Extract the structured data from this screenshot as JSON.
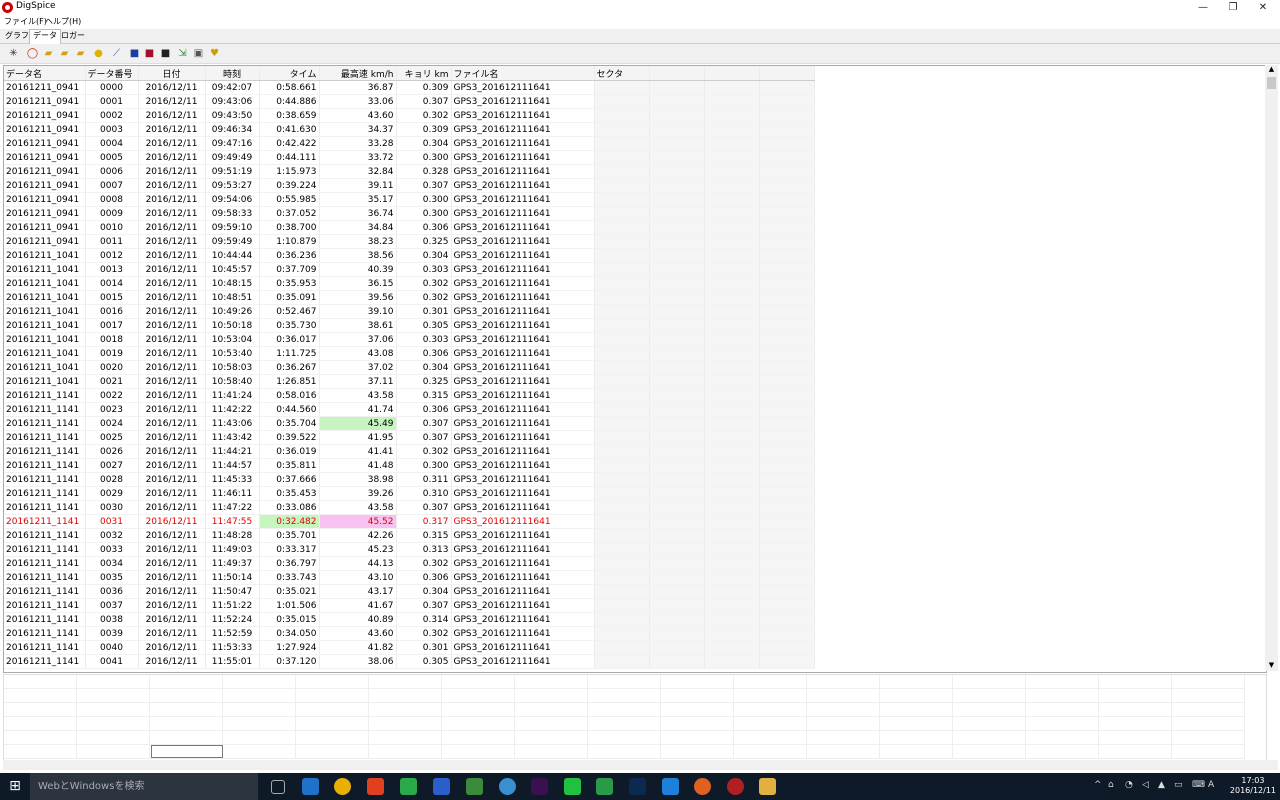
{
  "window": {
    "title": "DigSpice",
    "controls": {
      "minimize": "—",
      "maximize": "❐",
      "close": "✕"
    }
  },
  "menu": [
    "ファイル(F)",
    "ヘルプ(H)"
  ],
  "tabs": [
    {
      "label": "グラフ",
      "active": false
    },
    {
      "label": "データ",
      "active": true
    },
    {
      "label": "ロガー",
      "active": false
    }
  ],
  "toolbar_icons": [
    {
      "name": "spark-icon",
      "glyph": "✳",
      "color": "#333333"
    },
    {
      "name": "ring-icon",
      "glyph": "◯",
      "color": "#cc2200"
    },
    {
      "name": "folder-open-icon",
      "glyph": "▰",
      "color": "#d4a017"
    },
    {
      "name": "folder-icon",
      "glyph": "▰",
      "color": "#d4a017"
    },
    {
      "name": "folder-add-icon",
      "glyph": "▰",
      "color": "#d4a017"
    },
    {
      "name": "coin-icon",
      "glyph": "●",
      "color": "#e0b000"
    },
    {
      "name": "chart-icon",
      "glyph": "⟋",
      "color": "#2a5fc9"
    },
    {
      "name": "save-icon",
      "glyph": "■",
      "color": "#1c3fa0"
    },
    {
      "name": "save-red-icon",
      "glyph": "■",
      "color": "#a0102a"
    },
    {
      "name": "save-dark-icon",
      "glyph": "■",
      "color": "#202020"
    },
    {
      "name": "export-icon",
      "glyph": "⇲",
      "color": "#2a8a2a"
    },
    {
      "name": "picture-icon",
      "glyph": "▣",
      "color": "#555555"
    },
    {
      "name": "trophy-icon",
      "glyph": "♥",
      "color": "#c9a000"
    }
  ],
  "table": {
    "columns": [
      "データ名",
      "データ番号",
      "日付",
      "時刻",
      "タイム",
      "最高速 km/h",
      "キョリ km",
      "ファイル名",
      "セクタ"
    ],
    "rows": [
      [
        "20161211_0941",
        "0000",
        "2016/12/11",
        "09:42:07",
        "0:58.661",
        "36.87",
        "0.309",
        "GPS3_201612111641"
      ],
      [
        "20161211_0941",
        "0001",
        "2016/12/11",
        "09:43:06",
        "0:44.886",
        "33.06",
        "0.307",
        "GPS3_201612111641"
      ],
      [
        "20161211_0941",
        "0002",
        "2016/12/11",
        "09:43:50",
        "0:38.659",
        "43.60",
        "0.302",
        "GPS3_201612111641"
      ],
      [
        "20161211_0941",
        "0003",
        "2016/12/11",
        "09:46:34",
        "0:41.630",
        "34.37",
        "0.309",
        "GPS3_201612111641"
      ],
      [
        "20161211_0941",
        "0004",
        "2016/12/11",
        "09:47:16",
        "0:42.422",
        "33.28",
        "0.304",
        "GPS3_201612111641"
      ],
      [
        "20161211_0941",
        "0005",
        "2016/12/11",
        "09:49:49",
        "0:44.111",
        "33.72",
        "0.300",
        "GPS3_201612111641"
      ],
      [
        "20161211_0941",
        "0006",
        "2016/12/11",
        "09:51:19",
        "1:15.973",
        "32.84",
        "0.328",
        "GPS3_201612111641"
      ],
      [
        "20161211_0941",
        "0007",
        "2016/12/11",
        "09:53:27",
        "0:39.224",
        "39.11",
        "0.307",
        "GPS3_201612111641"
      ],
      [
        "20161211_0941",
        "0008",
        "2016/12/11",
        "09:54:06",
        "0:55.985",
        "35.17",
        "0.300",
        "GPS3_201612111641"
      ],
      [
        "20161211_0941",
        "0009",
        "2016/12/11",
        "09:58:33",
        "0:37.052",
        "36.74",
        "0.300",
        "GPS3_201612111641"
      ],
      [
        "20161211_0941",
        "0010",
        "2016/12/11",
        "09:59:10",
        "0:38.700",
        "34.84",
        "0.306",
        "GPS3_201612111641"
      ],
      [
        "20161211_0941",
        "0011",
        "2016/12/11",
        "09:59:49",
        "1:10.879",
        "38.23",
        "0.325",
        "GPS3_201612111641"
      ],
      [
        "20161211_1041",
        "0012",
        "2016/12/11",
        "10:44:44",
        "0:36.236",
        "38.56",
        "0.304",
        "GPS3_201612111641"
      ],
      [
        "20161211_1041",
        "0013",
        "2016/12/11",
        "10:45:57",
        "0:37.709",
        "40.39",
        "0.303",
        "GPS3_201612111641"
      ],
      [
        "20161211_1041",
        "0014",
        "2016/12/11",
        "10:48:15",
        "0:35.953",
        "36.15",
        "0.302",
        "GPS3_201612111641"
      ],
      [
        "20161211_1041",
        "0015",
        "2016/12/11",
        "10:48:51",
        "0:35.091",
        "39.56",
        "0.302",
        "GPS3_201612111641"
      ],
      [
        "20161211_1041",
        "0016",
        "2016/12/11",
        "10:49:26",
        "0:52.467",
        "39.10",
        "0.301",
        "GPS3_201612111641"
      ],
      [
        "20161211_1041",
        "0017",
        "2016/12/11",
        "10:50:18",
        "0:35.730",
        "38.61",
        "0.305",
        "GPS3_201612111641"
      ],
      [
        "20161211_1041",
        "0018",
        "2016/12/11",
        "10:53:04",
        "0:36.017",
        "37.06",
        "0.303",
        "GPS3_201612111641"
      ],
      [
        "20161211_1041",
        "0019",
        "2016/12/11",
        "10:53:40",
        "1:11.725",
        "43.08",
        "0.306",
        "GPS3_201612111641"
      ],
      [
        "20161211_1041",
        "0020",
        "2016/12/11",
        "10:58:03",
        "0:36.267",
        "37.02",
        "0.304",
        "GPS3_201612111641"
      ],
      [
        "20161211_1041",
        "0021",
        "2016/12/11",
        "10:58:40",
        "1:26.851",
        "37.11",
        "0.325",
        "GPS3_201612111641"
      ],
      [
        "20161211_1141",
        "0022",
        "2016/12/11",
        "11:41:24",
        "0:58.016",
        "43.58",
        "0.315",
        "GPS3_201612111641"
      ],
      [
        "20161211_1141",
        "0023",
        "2016/12/11",
        "11:42:22",
        "0:44.560",
        "41.74",
        "0.306",
        "GPS3_201612111641"
      ],
      [
        "20161211_1141",
        "0024",
        "2016/12/11",
        "11:43:06",
        "0:35.704",
        "45.49",
        "0.307",
        "GPS3_201612111641"
      ],
      [
        "20161211_1141",
        "0025",
        "2016/12/11",
        "11:43:42",
        "0:39.522",
        "41.95",
        "0.307",
        "GPS3_201612111641"
      ],
      [
        "20161211_1141",
        "0026",
        "2016/12/11",
        "11:44:21",
        "0:36.019",
        "41.41",
        "0.302",
        "GPS3_201612111641"
      ],
      [
        "20161211_1141",
        "0027",
        "2016/12/11",
        "11:44:57",
        "0:35.811",
        "41.48",
        "0.300",
        "GPS3_201612111641"
      ],
      [
        "20161211_1141",
        "0028",
        "2016/12/11",
        "11:45:33",
        "0:37.666",
        "38.98",
        "0.311",
        "GPS3_201612111641"
      ],
      [
        "20161211_1141",
        "0029",
        "2016/12/11",
        "11:46:11",
        "0:35.453",
        "39.26",
        "0.310",
        "GPS3_201612111641"
      ],
      [
        "20161211_1141",
        "0030",
        "2016/12/11",
        "11:47:22",
        "0:33.086",
        "43.58",
        "0.307",
        "GPS3_201612111641"
      ],
      [
        "20161211_1141",
        "0031",
        "2016/12/11",
        "11:47:55",
        "0:32.482",
        "45.52",
        "0.317",
        "GPS3_201612111641"
      ],
      [
        "20161211_1141",
        "0032",
        "2016/12/11",
        "11:48:28",
        "0:35.701",
        "42.26",
        "0.315",
        "GPS3_201612111641"
      ],
      [
        "20161211_1141",
        "0033",
        "2016/12/11",
        "11:49:03",
        "0:33.317",
        "45.23",
        "0.313",
        "GPS3_201612111641"
      ],
      [
        "20161211_1141",
        "0034",
        "2016/12/11",
        "11:49:37",
        "0:36.797",
        "44.13",
        "0.302",
        "GPS3_201612111641"
      ],
      [
        "20161211_1141",
        "0035",
        "2016/12/11",
        "11:50:14",
        "0:33.743",
        "43.10",
        "0.306",
        "GPS3_201612111641"
      ],
      [
        "20161211_1141",
        "0036",
        "2016/12/11",
        "11:50:47",
        "0:35.021",
        "43.17",
        "0.304",
        "GPS3_201612111641"
      ],
      [
        "20161211_1141",
        "0037",
        "2016/12/11",
        "11:51:22",
        "1:01.506",
        "41.67",
        "0.307",
        "GPS3_201612111641"
      ],
      [
        "20161211_1141",
        "0038",
        "2016/12/11",
        "11:52:24",
        "0:35.015",
        "40.89",
        "0.314",
        "GPS3_201612111641"
      ],
      [
        "20161211_1141",
        "0039",
        "2016/12/11",
        "11:52:59",
        "0:34.050",
        "43.60",
        "0.302",
        "GPS3_201612111641"
      ],
      [
        "20161211_1141",
        "0040",
        "2016/12/11",
        "11:53:33",
        "1:27.924",
        "41.82",
        "0.301",
        "GPS3_201612111641"
      ],
      [
        "20161211_1141",
        "0041",
        "2016/12/11",
        "11:55:01",
        "0:37.120",
        "38.06",
        "0.305",
        "GPS3_201612111641"
      ]
    ],
    "best_row_index": 31,
    "fastest_speed_row_index": 24,
    "highlight_colors": {
      "best_text": "#e00000",
      "best_time_bg": "#c6f5c0",
      "best_speed_bg": "#f7c2ef"
    }
  },
  "taskbar": {
    "search_placeholder": "WebとWindowsを検索",
    "clock_time": "17:03",
    "clock_date": "2016/12/11"
  }
}
